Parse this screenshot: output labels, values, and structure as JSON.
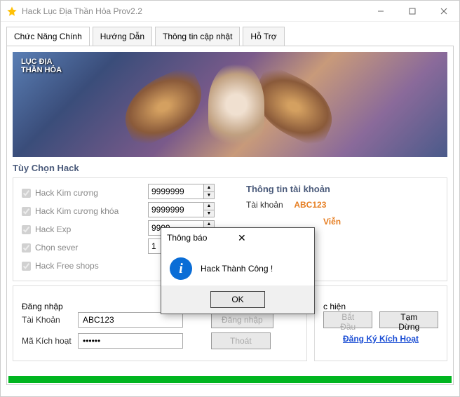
{
  "window": {
    "title": "Hack Lục Địa Thần Hỏa  Prov2.2"
  },
  "tabs": {
    "t0": "Chức Năng Chính",
    "t1": "Hướng Dẫn",
    "t2": "Thông tin cập nhật",
    "t3": "Hỗ Trợ"
  },
  "banner": {
    "logo_line1": "LỤC ĐỊA",
    "logo_line2": "THẦN HỎA"
  },
  "options": {
    "section_title": "Tùy Chọn Hack",
    "c0": "Hack Kim cương",
    "c1": "Hack Kim cương khóa",
    "c2": "Hack Exp",
    "c3": "Chọn sever",
    "c4": "Hack Free shops",
    "v0": "9999999",
    "v1": "9999999",
    "v2": "9999",
    "v3": "1"
  },
  "account_info": {
    "title": "Thông tin tài khoản",
    "row0_label": "Tài khoản",
    "row0_value": "ABC123",
    "row1_value_suffix": "Viễn"
  },
  "login": {
    "legend": "Đăng nhập",
    "user_label": "Tài Khoản",
    "user_value": "ABC123",
    "code_label": "Mã Kích hoạt",
    "code_value": "••••••",
    "btn_login": "Đăng nhập",
    "btn_exit": "Thoát"
  },
  "exec": {
    "legend_suffix": "c hiện",
    "btn_start": "Bắt Đầu",
    "btn_pause": "Tạm Dừng",
    "link": "Đăng Ký Kích Hoạt"
  },
  "dialog": {
    "title": "Thông báo",
    "message": "Hack Thành Công !",
    "ok": "OK"
  }
}
